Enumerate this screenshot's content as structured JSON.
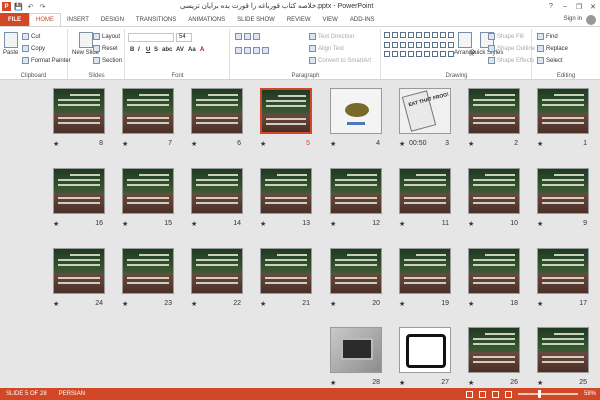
{
  "window": {
    "title": "خلاصه کتاب قورباغه را قورت بده برایان تریسی.pptx - PowerPoint",
    "help": "?",
    "minimize": "–",
    "restore": "❐",
    "close": "✕"
  },
  "qat": {
    "save": "💾",
    "undo": "↶",
    "redo": "↷"
  },
  "tabs": [
    "FILE",
    "HOME",
    "INSERT",
    "DESIGN",
    "TRANSITIONS",
    "ANIMATIONS",
    "SLIDE SHOW",
    "REVIEW",
    "VIEW",
    "ADD-INS"
  ],
  "active_tab": "HOME",
  "signin": "Sign in",
  "ribbon": {
    "clipboard": {
      "label": "Clipboard",
      "paste": "Paste",
      "cut": "Cut",
      "copy": "Copy",
      "format_painter": "Format Painter"
    },
    "slides": {
      "label": "Slides",
      "new_slide": "New Slide",
      "layout": "Layout",
      "reset": "Reset",
      "section": "Section"
    },
    "font": {
      "label": "Font",
      "size": "54",
      "bold": "B",
      "italic": "I",
      "underline": "U",
      "strike": "S",
      "shadow": "abc",
      "spacing": "AV",
      "case": "Aa",
      "color": "A"
    },
    "paragraph": {
      "label": "Paragraph",
      "text_direction": "Text Direction",
      "align_text": "Align Text",
      "convert": "Convert to SmartArt"
    },
    "drawing": {
      "label": "Drawing",
      "arrange": "Arrange",
      "quick_styles": "Quick Styles",
      "shape_fill": "Shape Fill",
      "shape_outline": "Shape Outline",
      "shape_effects": "Shape Effects"
    },
    "editing": {
      "label": "Editing",
      "find": "Find",
      "replace": "Replace",
      "select": "Select"
    }
  },
  "slides": [
    {
      "n": "1",
      "star": "★"
    },
    {
      "n": "2",
      "star": "★"
    },
    {
      "n": "3",
      "star": "★",
      "timing": "00:50"
    },
    {
      "n": "4",
      "star": "★"
    },
    {
      "n": "5",
      "star": "★"
    },
    {
      "n": "6",
      "star": "★"
    },
    {
      "n": "7",
      "star": "★"
    },
    {
      "n": "8",
      "star": "★"
    },
    {
      "n": "9",
      "star": "★"
    },
    {
      "n": "10",
      "star": "★"
    },
    {
      "n": "11",
      "star": "★"
    },
    {
      "n": "12",
      "star": "★"
    },
    {
      "n": "13",
      "star": "★"
    },
    {
      "n": "14",
      "star": "★"
    },
    {
      "n": "15",
      "star": "★"
    },
    {
      "n": "16",
      "star": "★"
    },
    {
      "n": "17",
      "star": "★"
    },
    {
      "n": "18",
      "star": "★"
    },
    {
      "n": "19",
      "star": "★"
    },
    {
      "n": "20",
      "star": "★"
    },
    {
      "n": "21",
      "star": "★"
    },
    {
      "n": "22",
      "star": "★"
    },
    {
      "n": "23",
      "star": "★"
    },
    {
      "n": "24",
      "star": "★"
    },
    {
      "n": "25",
      "star": "★"
    },
    {
      "n": "26",
      "star": "★"
    },
    {
      "n": "27",
      "star": "★"
    },
    {
      "n": "28",
      "star": "★"
    }
  ],
  "frog_title": "EAT THAT FROG!",
  "status": {
    "slide_of": "SLIDE 5 OF 28",
    "language": "PERSIAN",
    "zoom": "58%"
  }
}
